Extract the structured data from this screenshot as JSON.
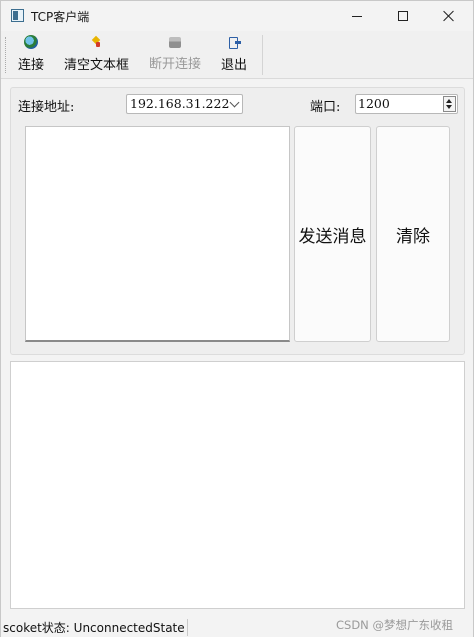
{
  "window": {
    "title": "TCP客户端"
  },
  "toolbar": {
    "items": [
      {
        "label": "连接",
        "icon": "connect-globe-icon",
        "enabled": true
      },
      {
        "label": "清空文本框",
        "icon": "clear-paint-icon",
        "enabled": true
      },
      {
        "label": "断开连接",
        "icon": "disconnect-drive-icon",
        "enabled": false
      },
      {
        "label": "退出",
        "icon": "exit-door-icon",
        "enabled": true
      }
    ]
  },
  "form": {
    "address_label": "连接地址:",
    "address_value": "192.168.31.222",
    "port_label": "端口:",
    "port_value": "1200"
  },
  "buttons": {
    "send_label": "发送消息",
    "clear_label": "清除"
  },
  "status": {
    "text": "scoket状态: UnconnectedState"
  },
  "watermark": "CSDN @梦想广东收租"
}
